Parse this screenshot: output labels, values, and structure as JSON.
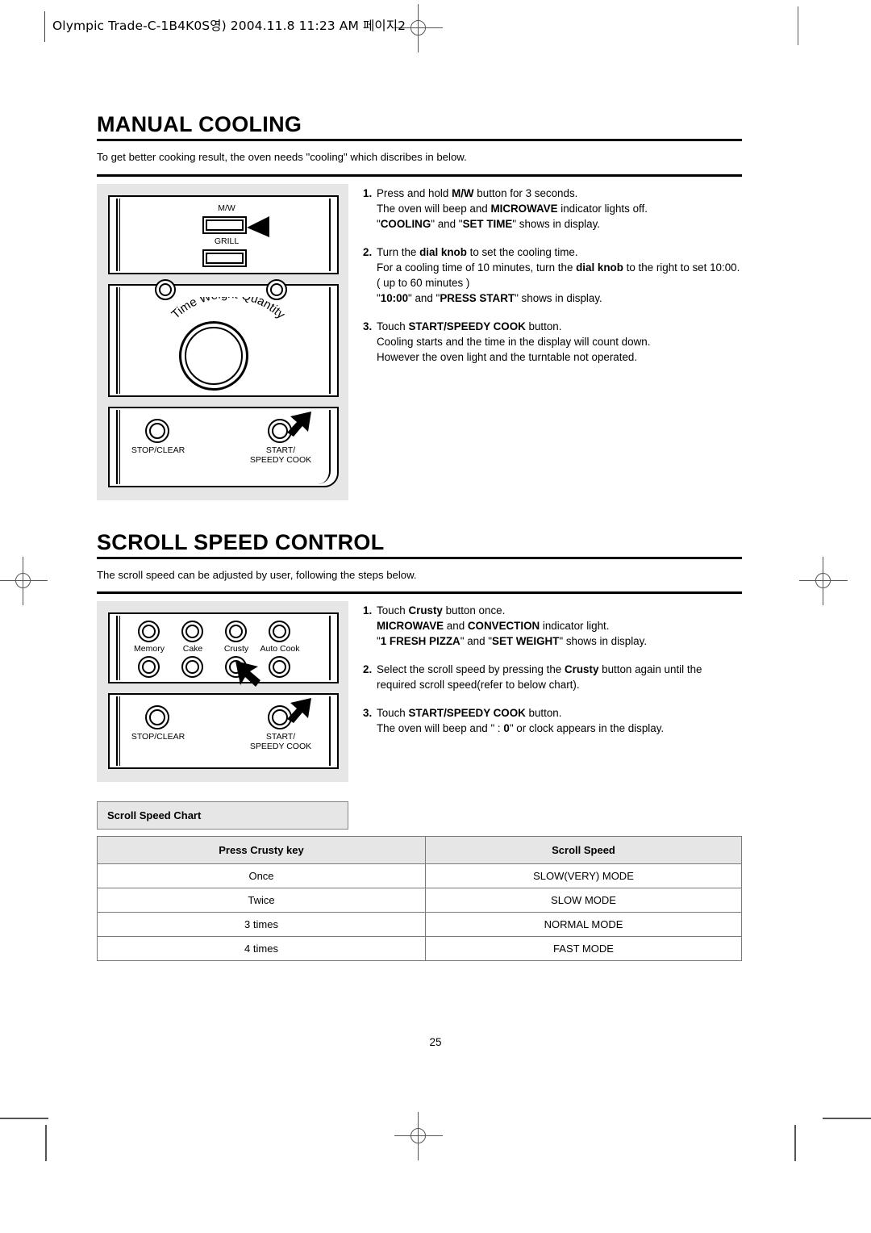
{
  "print": {
    "slug": "Olympic Trade-C-1B4K0S영)  2004.11.8 11:23 AM  페이지2",
    "page_number": "25"
  },
  "sections": [
    {
      "title": "MANUAL COOLING",
      "intro": "To get better cooking result, the oven needs \"cooling\" which discribes in below.",
      "steps": [
        {
          "num": "1.",
          "lines": [
            [
              {
                "t": "Press and hold ",
                "b": false
              },
              {
                "t": "M/W",
                "b": true
              },
              {
                "t": " button for 3 seconds.",
                "b": false
              }
            ],
            [
              {
                "t": "The oven will beep and ",
                "b": false
              },
              {
                "t": "MICROWAVE",
                "b": true
              },
              {
                "t": " indicator lights off.",
                "b": false
              }
            ],
            [
              {
                "t": "\"",
                "b": false
              },
              {
                "t": "COOLING",
                "b": true
              },
              {
                "t": "\" and \"",
                "b": false
              },
              {
                "t": "SET TIME",
                "b": true
              },
              {
                "t": "\" shows in display.",
                "b": false
              }
            ]
          ]
        },
        {
          "num": "2.",
          "lines": [
            [
              {
                "t": "Turn the ",
                "b": false
              },
              {
                "t": "dial knob",
                "b": true
              },
              {
                "t": " to set the cooling time.",
                "b": false
              }
            ],
            [
              {
                "t": "For a cooling time of 10 minutes, turn the ",
                "b": false
              },
              {
                "t": "dial knob",
                "b": true
              },
              {
                "t": " to the right to set 10:00.( up to 60 minutes )",
                "b": false
              }
            ],
            [
              {
                "t": "\"",
                "b": false
              },
              {
                "t": "10:00",
                "b": true
              },
              {
                "t": "\" and \"",
                "b": false
              },
              {
                "t": "PRESS START",
                "b": true
              },
              {
                "t": "\" shows in display.",
                "b": false
              }
            ]
          ]
        },
        {
          "num": "3.",
          "lines": [
            [
              {
                "t": "Touch ",
                "b": false
              },
              {
                "t": "START/SPEEDY COOK",
                "b": true
              },
              {
                "t": " button.",
                "b": false
              }
            ],
            [
              {
                "t": "Cooling starts and the time in the display will count down.",
                "b": false
              }
            ],
            [
              {
                "t": "However the oven light and the turntable not operated.",
                "b": false
              }
            ]
          ]
        }
      ]
    },
    {
      "title": "SCROLL SPEED CONTROL",
      "intro": "The scroll speed can be adjusted by user, following the steps below.",
      "steps": [
        {
          "num": "1.",
          "lines": [
            [
              {
                "t": "Touch ",
                "b": false
              },
              {
                "t": "Crusty",
                "b": true
              },
              {
                "t": " button once.",
                "b": false
              }
            ],
            [
              {
                "t": "MICROWAVE",
                "b": true
              },
              {
                "t": " and ",
                "b": false
              },
              {
                "t": "CONVECTION",
                "b": true
              },
              {
                "t": " indicator light.",
                "b": false
              }
            ],
            [
              {
                "t": "\"",
                "b": false
              },
              {
                "t": "1 FRESH PIZZA",
                "b": true
              },
              {
                "t": "\" and \"",
                "b": false
              },
              {
                "t": "SET WEIGHT",
                "b": true
              },
              {
                "t": "\" shows in display.",
                "b": false
              }
            ]
          ]
        },
        {
          "num": "2.",
          "lines": [
            [
              {
                "t": "Select the scroll speed by pressing the ",
                "b": false
              },
              {
                "t": "Crusty",
                "b": true
              },
              {
                "t": " button again until the required scroll speed(refer to below chart).",
                "b": false
              }
            ]
          ]
        },
        {
          "num": "3.",
          "lines": [
            [
              {
                "t": "Touch ",
                "b": false
              },
              {
                "t": "START/SPEEDY COOK",
                "b": true
              },
              {
                "t": " button.",
                "b": false
              }
            ],
            [
              {
                "t": "The oven will beep and \" : ",
                "b": false
              },
              {
                "t": "0",
                "b": true
              },
              {
                "t": "\" or clock appears in the display.",
                "b": false
              }
            ]
          ]
        }
      ]
    }
  ],
  "control_panel_1": {
    "mw_label": "M/W",
    "grill_label": "GRILL",
    "dial_label": "Time Weight Quantity",
    "dial_label_chars": [
      "T",
      "i",
      "m",
      "e",
      " ",
      "W",
      "e",
      "i",
      "g",
      "h",
      "t",
      " ",
      "Q",
      "u",
      "a",
      "n",
      "t",
      "i",
      "t",
      "y"
    ],
    "stop_label": "STOP/CLEAR",
    "start_label_line1": "START/",
    "start_label_line2": "SPEEDY COOK"
  },
  "control_panel_2": {
    "pads": [
      "Memory",
      "Cake",
      "Crusty",
      "Auto Cook"
    ],
    "stop_label": "STOP/CLEAR",
    "start_label_line1": "START/",
    "start_label_line2": "SPEEDY COOK"
  },
  "chart": {
    "caption": "Scroll Speed Chart",
    "headers": [
      "Press Crusty key",
      "Scroll Speed"
    ],
    "rows": [
      [
        "Once",
        "SLOW(VERY) MODE"
      ],
      [
        "Twice",
        "SLOW MODE"
      ],
      [
        "3 times",
        "NORMAL MODE"
      ],
      [
        "4 times",
        "FAST MODE"
      ]
    ]
  }
}
